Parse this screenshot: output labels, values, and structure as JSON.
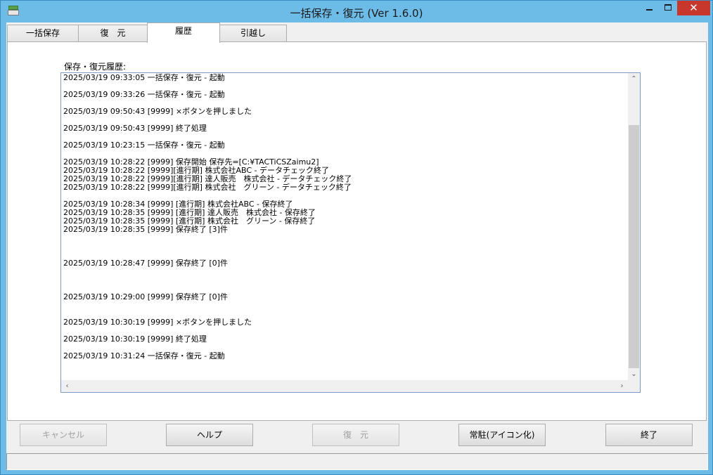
{
  "window": {
    "title": "一括保存・復元 (Ver 1.6.0)",
    "close_glyph": "✕"
  },
  "tabs": [
    {
      "label": "一括保存"
    },
    {
      "label": "復　元"
    },
    {
      "label": "履歴"
    },
    {
      "label": "引越し"
    }
  ],
  "history": {
    "label": "保存・復元履歴:",
    "lines": [
      "2025/03/19 09:33:05 一括保存・復元 - 起動",
      "",
      "2025/03/19 09:33:26 一括保存・復元 - 起動",
      "",
      "2025/03/19 09:50:43 [9999] ×ボタンを押しました",
      "",
      "2025/03/19 09:50:43 [9999] 終了処理",
      "",
      "2025/03/19 10:23:15 一括保存・復元 - 起動",
      "",
      "2025/03/19 10:28:22 [9999] 保存開始 保存先=[C:¥TACTiCSZaimu2]",
      "2025/03/19 10:28:22 [9999][進行期] 株式会社ABC - データチェック終了",
      "2025/03/19 10:28:22 [9999][進行期] 達人販売　株式会社 - データチェック終了",
      "2025/03/19 10:28:22 [9999][進行期] 株式会社　グリーン - データチェック終了",
      "",
      "2025/03/19 10:28:34 [9999] [進行期] 株式会社ABC - 保存終了",
      "2025/03/19 10:28:35 [9999] [進行期] 達人販売　株式会社 - 保存終了",
      "2025/03/19 10:28:35 [9999] [進行期] 株式会社　グリーン - 保存終了",
      "2025/03/19 10:28:35 [9999] 保存終了 [3]件",
      "",
      "",
      "",
      "2025/03/19 10:28:47 [9999] 保存終了 [0]件",
      "",
      "",
      "",
      "2025/03/19 10:29:00 [9999] 保存終了 [0]件",
      "",
      "",
      "2025/03/19 10:30:19 [9999] ×ボタンを押しました",
      "",
      "2025/03/19 10:30:19 [9999] 終了処理",
      "",
      "2025/03/19 10:31:24 一括保存・復元 - 起動"
    ]
  },
  "buttons": {
    "cancel": "キャンセル",
    "help": "ヘルプ",
    "restore": "復　元",
    "resident": "常駐(アイコン化)",
    "exit": "終了"
  },
  "icons": {
    "scroll_up": "⌃",
    "scroll_down": "⌄",
    "scroll_left": "‹",
    "scroll_right": "›"
  }
}
